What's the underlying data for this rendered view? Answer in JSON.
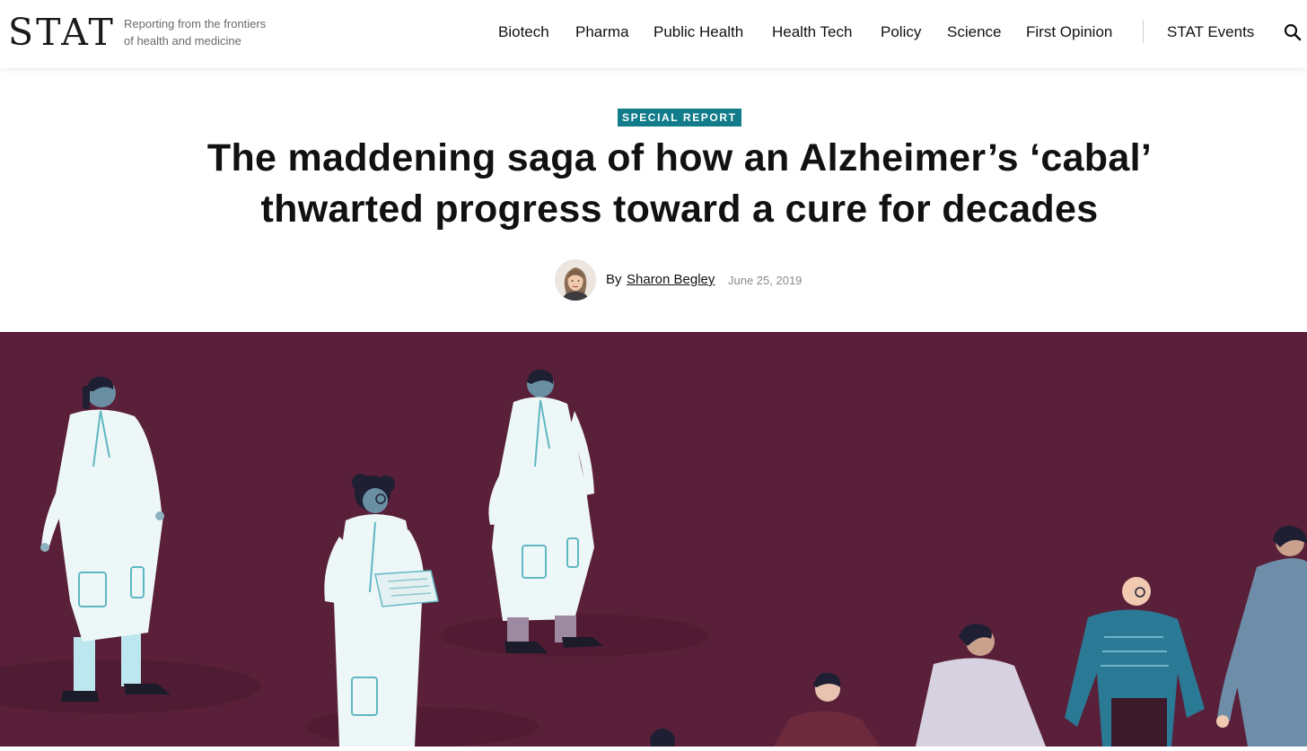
{
  "brand": {
    "logo": "STAT",
    "tagline_line1": "Reporting from the frontiers",
    "tagline_line2": "of health and medicine"
  },
  "nav": {
    "items": [
      "Biotech",
      "Pharma",
      "Public Health",
      "Health Tech",
      "Policy",
      "Science",
      "First Opinion"
    ],
    "events": "STAT Events",
    "search_icon": "search-icon"
  },
  "article": {
    "section": "SPECIAL REPORT",
    "headline_line1": "The maddening saga of how an Alzheimer’s ‘cabal’",
    "headline_line2": "thwarted progress toward a cure for decades",
    "by_prefix": "By",
    "author": "Sharon Begley",
    "date": "June 25, 2019"
  },
  "hero": {
    "background_color": "#5a2039"
  },
  "colors": {
    "badge": "#127c8a",
    "text": "#111111",
    "muted": "#8a8a8a"
  }
}
